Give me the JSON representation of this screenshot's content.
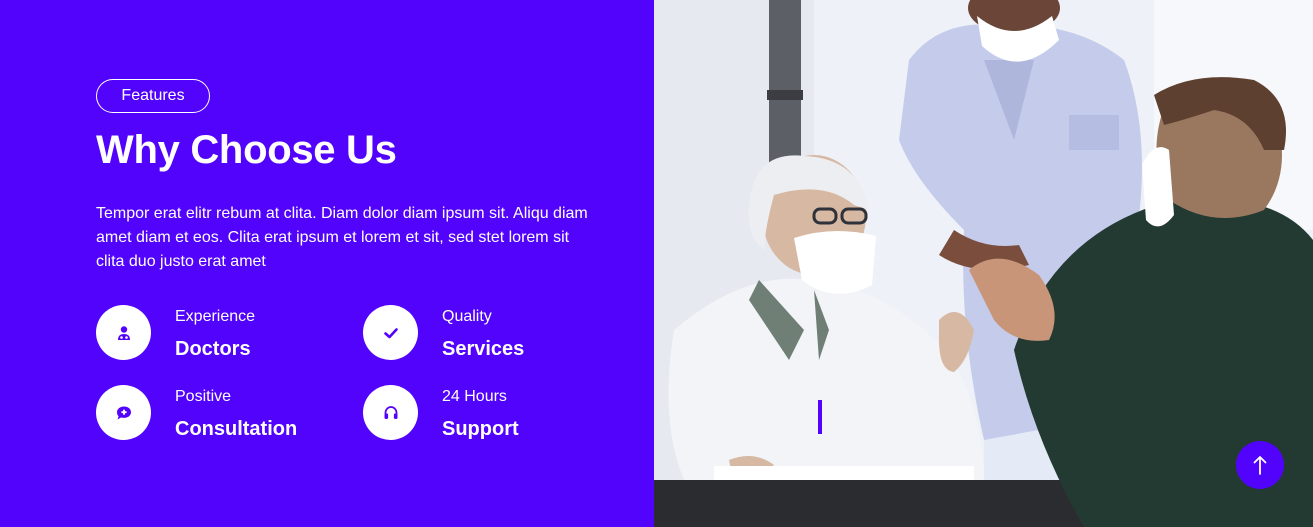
{
  "section": {
    "badge": "Features",
    "title": "Why Choose Us",
    "description": "Tempor erat elitr rebum at clita. Diam dolor diam ipsum sit. Aliqu diam amet diam et eos. Clita erat ipsum et lorem et sit, sed stet lorem sit clita duo justo erat amet"
  },
  "features": [
    {
      "small": "Experience",
      "big": "Doctors",
      "icon": "doctor-icon"
    },
    {
      "small": "Quality",
      "big": "Services",
      "icon": "check-icon"
    },
    {
      "small": "Positive",
      "big": "Consultation",
      "icon": "comment-medical-icon"
    },
    {
      "small": "24 Hours",
      "big": "Support",
      "icon": "headphones-icon"
    }
  ],
  "colors": {
    "accent": "#5203fb",
    "text_on_accent": "#ffffff"
  },
  "back_to_top": {
    "icon": "arrow-up-icon"
  }
}
